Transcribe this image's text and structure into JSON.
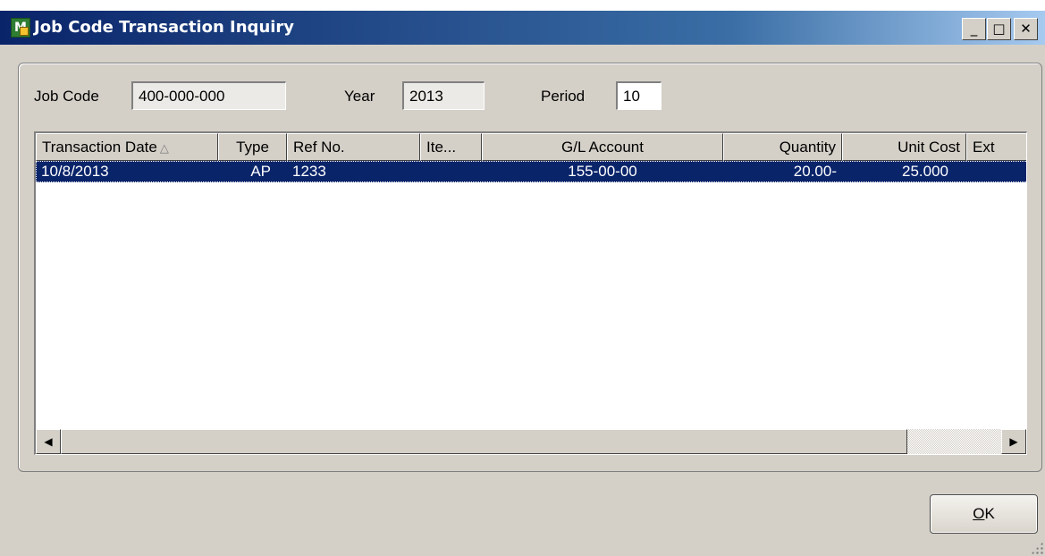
{
  "window": {
    "title": "Job Code Transaction Inquiry",
    "app_icon_text": "M",
    "controls": {
      "minimize": "_",
      "maximize": "□",
      "close": "✕"
    }
  },
  "filters": {
    "job_code_label": "Job Code",
    "job_code_value": "400-000-000",
    "year_label": "Year",
    "year_value": "2013",
    "period_label": "Period",
    "period_value": "10"
  },
  "grid": {
    "sort_indicator": "△",
    "columns": [
      "Transaction Date",
      "Type",
      "Ref No.",
      "Ite...",
      "G/L Account",
      "Quantity",
      "Unit Cost",
      "Ext"
    ],
    "rows": [
      {
        "transaction_date": "10/8/2013",
        "type": "AP",
        "ref_no": "1233",
        "item": "",
        "gl_account": "155-00-00",
        "quantity": "20.00-",
        "unit_cost": "25.000",
        "ext": ""
      }
    ],
    "scroll_left_arrow": "◀",
    "scroll_right_arrow": "▶"
  },
  "buttons": {
    "ok_mnemonic": "O",
    "ok_rest": "K"
  },
  "colors": {
    "title_gradient_start": "#0a246a",
    "selection": "#0a246a",
    "face": "#d4d0c8"
  }
}
